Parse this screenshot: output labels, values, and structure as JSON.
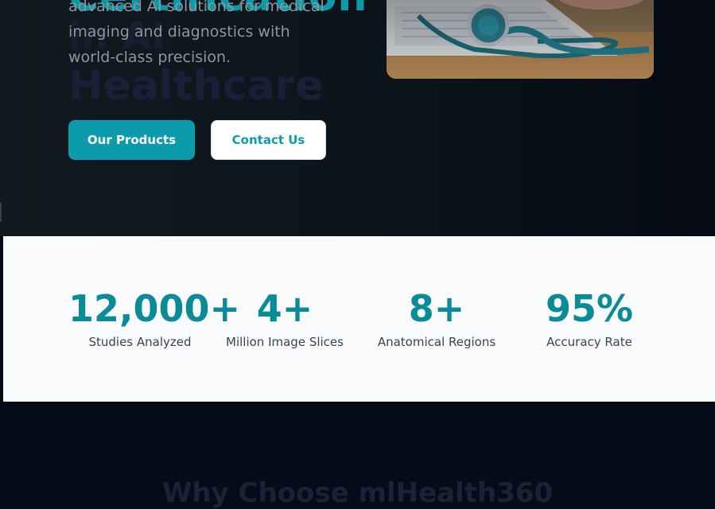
{
  "hero": {
    "heading": "Certification",
    "ghost_line_1": "in AI",
    "ghost_line_2": "Healthcare",
    "description": "advanced AI solutions for medical imaging and diagnostics with world-class precision.",
    "primary_button": "Our Products",
    "secondary_button": "Contact Us",
    "image_subject": "stethoscope-on-laptop-photo"
  },
  "stats": [
    {
      "value": "12,000+",
      "label": "Studies Analyzed"
    },
    {
      "value": "4+",
      "label": "Million Image Slices"
    },
    {
      "value": "8+",
      "label": "Anatomical Regions"
    },
    {
      "value": "95%",
      "label": "Accuracy Rate"
    }
  ],
  "why_section": {
    "heading": "Why Choose mlHealth360"
  },
  "colors": {
    "accent": "#0b9bab",
    "hero_bg": "#0d151b",
    "stats_bg": "#f8fafc",
    "page_bg": "#060b18"
  }
}
